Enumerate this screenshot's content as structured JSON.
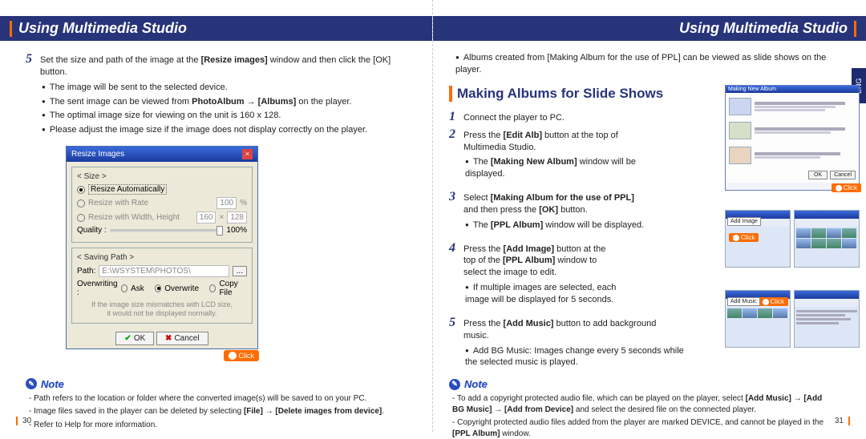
{
  "header": {
    "title_left": "Using Multimedia Studio",
    "title_right": "Using Multimedia Studio"
  },
  "left": {
    "step5": {
      "num": "5",
      "text_pre": "Set the size and path of the image at the ",
      "text_bold": "[Resize images]",
      "text_post": " window and then click the [OK] button."
    },
    "bullets": [
      "The image will be sent to the selected device.",
      "The sent image can be viewed from <b>PhotoAlbum</b> → <b>[Albums]</b> on the player.",
      "The optimal image size for viewing on the unit is 160 x 128.",
      "Please adjust the image size if the image does not display correctly on the player."
    ],
    "dialog": {
      "title": "Resize Images",
      "size_legend": "< Size >",
      "opt_auto": "Resize Automatically",
      "opt_rate": "Resize with Rate",
      "rate_val": "100",
      "rate_unit": "%",
      "opt_wh": "Resize with Width, Height",
      "w_val": "160",
      "h_val": "128",
      "quality_label": "Quality :",
      "quality_val": "100%",
      "path_legend": "< Saving Path >",
      "path_label": "Path:",
      "path_value": "E:\\WSYSTEM\\PHOTOS\\",
      "over_label": "Overwriting :",
      "over_ask": "Ask",
      "over_ow": "Overwrite",
      "over_copy": "Copy File",
      "hint1": "If the image size mismatches with LCD size,",
      "hint2": "it would not be displayed normally.",
      "ok": "OK",
      "cancel": "Cancel",
      "click": "Click"
    },
    "note_label": "Note",
    "notes": [
      "Path refers to the location or folder where the converted image(s) will be saved to on your PC.",
      "Image files saved in the player can be deleted by selecting <b>[File]</b> → <b>[Delete images from device]</b>.",
      "Refer to Help for more information."
    ],
    "pagenum": "30"
  },
  "right": {
    "top_bullet": "Albums created from [Making Album for the use of PPL] can be viewed as slide shows on the player.",
    "section": "Making Albums for Slide Shows",
    "steps": {
      "s1": {
        "num": "1",
        "text": "Connect the player to PC."
      },
      "s2": {
        "num": "2",
        "pre": "Press the ",
        "b1": "[Edit Alb]",
        "post": " button at the top of Multimedia Studio.",
        "sub": "The <b>[Making New Album]</b> window will be displayed."
      },
      "s3": {
        "num": "3",
        "pre": "Select ",
        "b1": "[Making Album for the use of PPL]",
        "mid": " and then press the ",
        "b2": "[OK]",
        "post": " button.",
        "sub": "The <b>[PPL Album]</b> window will be displayed."
      },
      "s4": {
        "num": "4",
        "pre": "Press the ",
        "b1": "[Add Image]",
        "mid": " button at the top of the ",
        "b2": "[PPL Album]",
        "post": " window to select the image to edit.",
        "sub": "If multiple images are selected, each image will be displayed for 5 seconds."
      },
      "s5": {
        "num": "5",
        "pre": "Press the ",
        "b1": "[Add Music]",
        "post": " button to add background music.",
        "sub": "Add BG Music: Images change every 5 seconds while the selected music is played."
      }
    },
    "thumbs": {
      "t1_title": "Making New Album",
      "add_image": "Add Image",
      "add_music": "Add Music",
      "click": "Click"
    },
    "note_label": "Note",
    "notes": [
      "To add a copyright protected audio file, which can be played on the player, select <b>[Add Music]</b> → <b>[Add BG Music]</b> → <b>[Add from Device]</b> and select the desired file on the connected player.",
      "Copyright protected audio files added from the player are marked DEVICE, and cannot be played in the <b>[PPL Album]</b> window."
    ],
    "pagenum": "31",
    "eng": "ENG"
  }
}
